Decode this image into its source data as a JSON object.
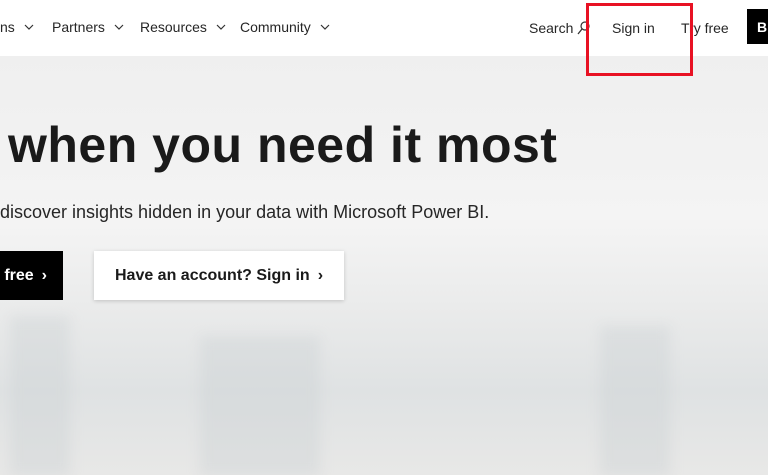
{
  "nav": {
    "items": [
      {
        "label": "ns"
      },
      {
        "label": "Partners"
      },
      {
        "label": "Resources"
      },
      {
        "label": "Community"
      }
    ],
    "search_label": "Search",
    "sign_in_label": "Sign in",
    "try_free_label": "Try free",
    "buy_label": "B"
  },
  "hero": {
    "title": "when you need it most",
    "subtitle": "discover insights hidden in your data with Microsoft Power BI.",
    "primary_button": "free",
    "secondary_button": "Have an account? Sign in",
    "chevron": "›"
  },
  "colors": {
    "highlight": "#e81123",
    "primary_button_bg": "#000000"
  }
}
